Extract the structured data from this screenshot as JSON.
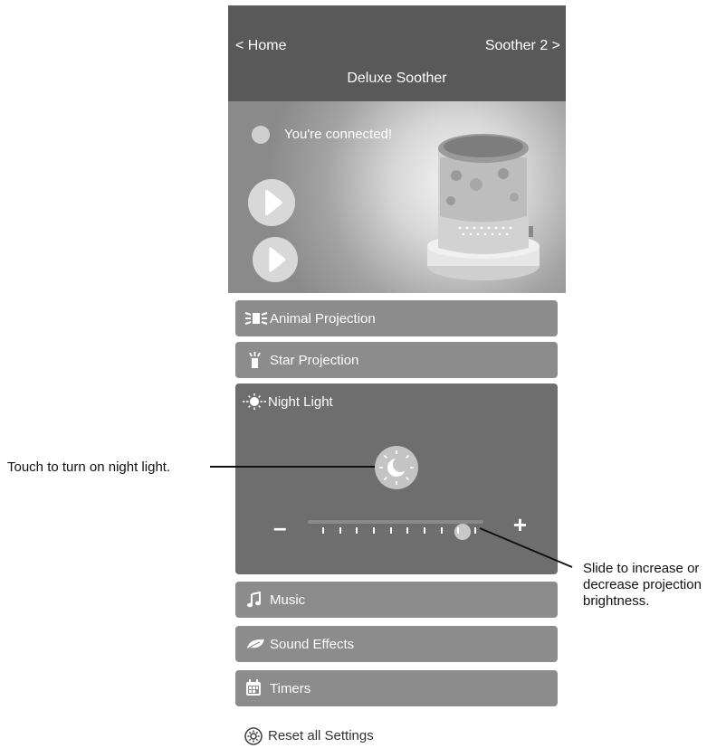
{
  "header": {
    "back_label": "< Home",
    "next_label": "Soother 2 >",
    "title": "Deluxe Soother"
  },
  "hero": {
    "status_text": "You're connected!",
    "play_buttons": [
      "play-icon",
      "play-icon"
    ]
  },
  "panels": {
    "animal": {
      "label": "Animal Projection",
      "icon": "animal-projection-icon"
    },
    "star": {
      "label": "Star Projection",
      "icon": "star-projection-icon"
    },
    "night": {
      "label": "Night Light",
      "icon": "sun-icon"
    },
    "music": {
      "label": "Music",
      "icon": "music-note-icon"
    },
    "sound": {
      "label": "Sound Effects",
      "icon": "leaf-icon"
    },
    "timers": {
      "label": "Timers",
      "icon": "calendar-icon"
    }
  },
  "night_light": {
    "button_icon": "moon-icon",
    "brightness_level": 0.88,
    "tick_count": 10
  },
  "reset": {
    "label": "Reset all Settings",
    "icon": "gear-icon"
  },
  "callouts": {
    "left": "Touch to turn on night light.",
    "right_lines": [
      "Slide to increase or",
      "decrease projection",
      "brightness."
    ]
  },
  "colors": {
    "header_bg": "#595959",
    "panel_bg": "#8c8c8c",
    "panel_open_bg": "#6e6e6e"
  }
}
